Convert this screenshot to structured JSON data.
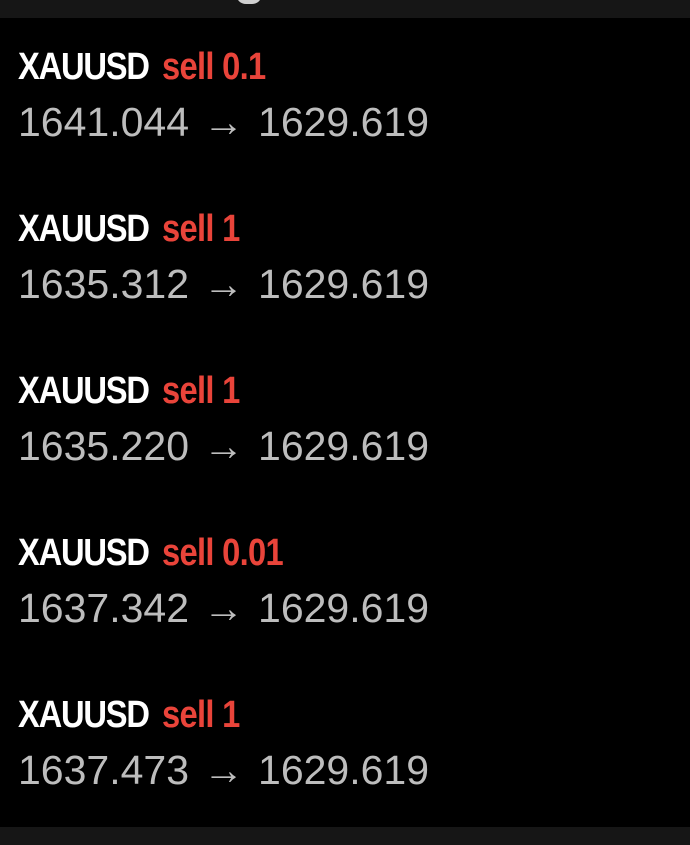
{
  "colors": {
    "background": "#000000",
    "symbol_text": "#ffffff",
    "sell_text": "#e9443a",
    "price_text": "#bdbdbd"
  },
  "icons": {
    "arrow": "right-arrow-icon"
  },
  "orders": [
    {
      "symbol": "XAUUSD",
      "side_volume": "sell 0.1",
      "open_price": "1641.044",
      "arrow": "→",
      "current_price": "1629.619"
    },
    {
      "symbol": "XAUUSD",
      "side_volume": "sell 1",
      "open_price": "1635.312",
      "arrow": "→",
      "current_price": "1629.619"
    },
    {
      "symbol": "XAUUSD",
      "side_volume": "sell 1",
      "open_price": "1635.220",
      "arrow": "→",
      "current_price": "1629.619"
    },
    {
      "symbol": "XAUUSD",
      "side_volume": "sell 0.01",
      "open_price": "1637.342",
      "arrow": "→",
      "current_price": "1629.619"
    },
    {
      "symbol": "XAUUSD",
      "side_volume": "sell 1",
      "open_price": "1637.473",
      "arrow": "→",
      "current_price": "1629.619"
    }
  ]
}
